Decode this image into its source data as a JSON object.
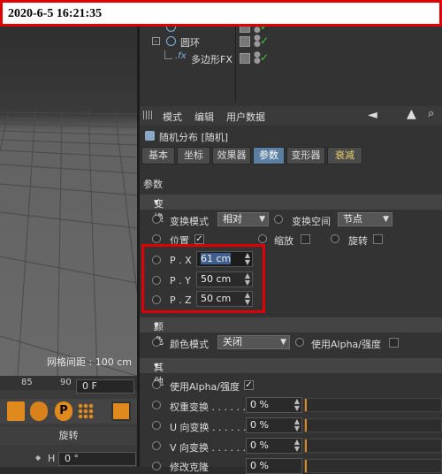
{
  "timestamp": "2020-6-5 16:21:35",
  "viewport": {
    "grid_spacing_label": "网格间距 : 100 cm"
  },
  "timeline": {
    "ruler_ticks": [
      "85",
      "90"
    ],
    "current_frame": "0 F",
    "section_label": "旋转",
    "h_label": "H",
    "h_value": "0 °"
  },
  "object_manager": {
    "rows": [
      {
        "name": "",
        "icon": "circle-icon"
      },
      {
        "name": "圆环",
        "icon": "circle-icon"
      },
      {
        "name": "多边形FX",
        "icon": "fx-icon"
      }
    ]
  },
  "attribute_manager": {
    "menus": [
      "模式",
      "编辑",
      "用户数据"
    ],
    "object_title": "随机分布 [随机]",
    "tabs": [
      "基本",
      "坐标",
      "效果器",
      "参数",
      "变形器",
      "衰减"
    ],
    "active_tab": "参数",
    "params_label": "参数",
    "transform": {
      "section": "变换",
      "transform_mode_label": "变换模式",
      "transform_mode_value": "相对",
      "transform_space_label": "变换空间",
      "transform_space_value": "节点",
      "position_label": "位置",
      "scale_label": "缩放",
      "rotation_label": "旋转",
      "px_label": "P . X",
      "px_value": "61 cm",
      "py_label": "P . Y",
      "py_value": "50 cm",
      "pz_label": "P . Z",
      "pz_value": "50 cm"
    },
    "color": {
      "section": "颜色",
      "color_mode_label": "颜色模式",
      "color_mode_value": "关闭",
      "use_alpha_label": "使用Alpha/强度"
    },
    "other": {
      "section": "其他",
      "use_alpha_label": "使用Alpha/强度",
      "weight_label": "权重变换 . . . . . .",
      "weight_value": "0 %",
      "u_label": "U 向变换 . . . . . .",
      "u_value": "0 %",
      "v_label": "V 向变换 . . . . . .",
      "v_value": "0 %",
      "mod_label": "修改克隆",
      "mod_value": "0 %"
    }
  },
  "colors": {
    "accent_red": "#e00000",
    "tab_active": "#5b7fa3",
    "slider_mark": "#e08a1e",
    "check_green": "#3ecf3e"
  }
}
